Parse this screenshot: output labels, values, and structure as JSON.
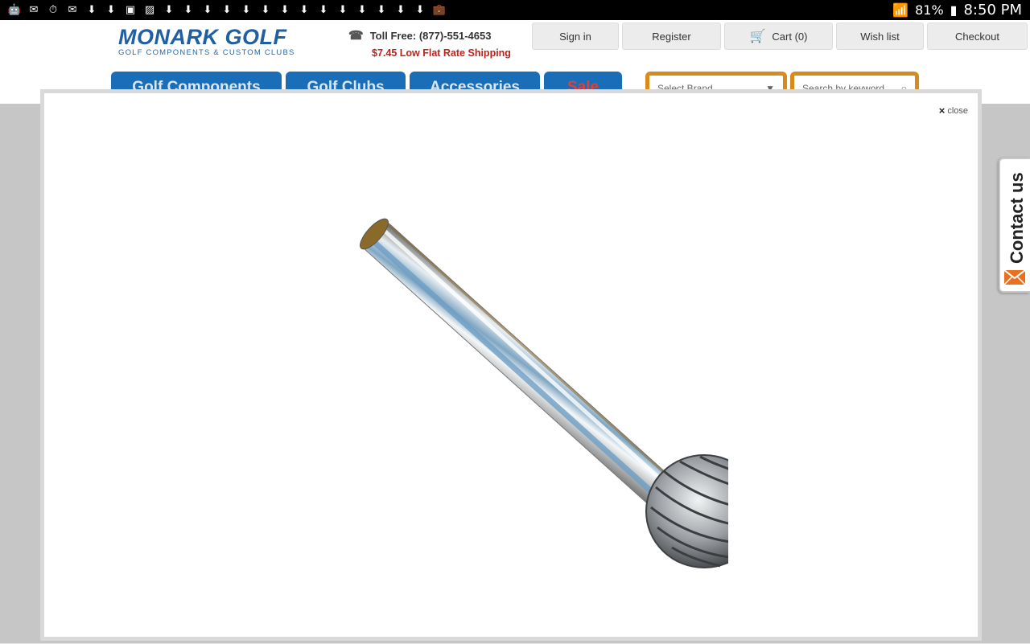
{
  "status_bar": {
    "notification_icons": [
      "android-icon",
      "mail-icon",
      "clock-icon",
      "gmail-icon",
      "download-icon",
      "download-icon",
      "save-icon",
      "image-icon",
      "download-icon",
      "download-icon",
      "download-icon",
      "download-icon",
      "download-icon",
      "download-icon",
      "download-icon",
      "download-icon",
      "download-icon",
      "download-icon",
      "download-icon",
      "download-icon",
      "download-icon",
      "download-icon",
      "briefcase-icon"
    ],
    "battery": "81%",
    "time": "8:50 PM"
  },
  "header": {
    "logo_main": "MONARK GOLF",
    "logo_sub": "GOLF COMPONENTS & CUSTOM CLUBS",
    "phone": "Toll Free: (877)-551-4653",
    "shipping": "$7.45 Low Flat Rate Shipping",
    "top_nav": {
      "sign_in": "Sign in",
      "register": "Register",
      "cart": "Cart (0)",
      "wish_list": "Wish list",
      "checkout": "Checkout"
    },
    "main_nav": {
      "golf_components": "Golf Components",
      "golf_clubs": "Golf Clubs",
      "accessories": "Accessories",
      "sale": "Sale"
    },
    "brand_select": "Select Brand",
    "search_placeholder": "Search by keyword"
  },
  "modal": {
    "close_label": "close"
  },
  "contact_tab": {
    "label": "Contact us"
  },
  "colors": {
    "brand_blue": "#1a6eb8",
    "sale_red": "#e0403a",
    "shipping_red": "#c0201a",
    "search_border": "#d98a1c"
  }
}
